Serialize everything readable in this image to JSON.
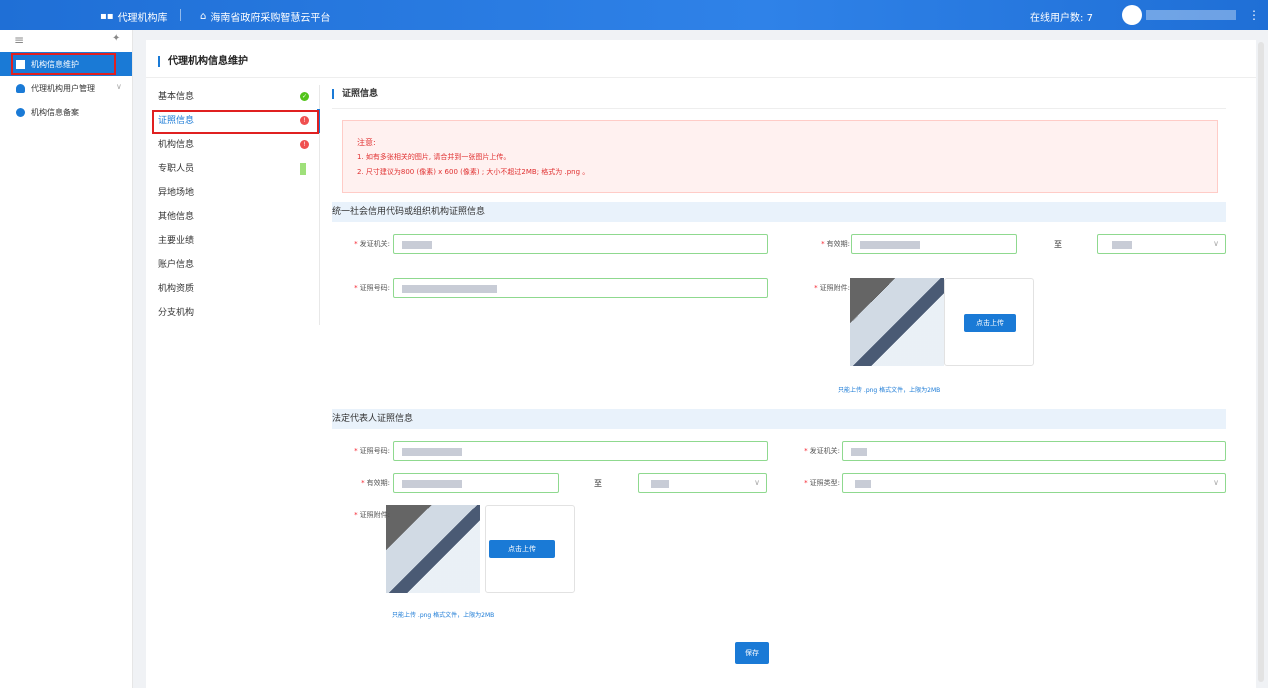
{
  "topbar": {
    "apps_icon": "grid-icon",
    "apps_label": "代理机构库",
    "home_icon": "home-icon",
    "platform": "海南省政府采购智慧云平台",
    "online_label": "在线用户数:",
    "online_count": "7",
    "more_icon": "more-icon"
  },
  "sidebar": {
    "menu_icon": "hamburger-icon",
    "pin_icon": "pin-icon",
    "items": [
      {
        "label": "机构信息维护",
        "icon": "info-icon"
      },
      {
        "label": "代理机构用户管理",
        "icon": "users-icon"
      },
      {
        "label": "机构信息备案",
        "icon": "gear-icon"
      }
    ]
  },
  "page_title": "代理机构信息维护",
  "nav": [
    {
      "label": "基本信息",
      "status": "ok"
    },
    {
      "label": "证照信息",
      "status": "err"
    },
    {
      "label": "机构信息",
      "status": "err"
    },
    {
      "label": "专职人员",
      "status": "bar"
    },
    {
      "label": "异地场地",
      "status": ""
    },
    {
      "label": "其他信息",
      "status": ""
    },
    {
      "label": "主要业绩",
      "status": ""
    },
    {
      "label": "账户信息",
      "status": ""
    },
    {
      "label": "机构资质",
      "status": ""
    },
    {
      "label": "分支机构",
      "status": ""
    }
  ],
  "section_title": "证照信息",
  "notice": {
    "title": "注意:",
    "line1": "1. 如有多张相关的图片, 请合并到一张图片上传。",
    "line2": "2. 尺寸建议为800 (像素) x 600 (像素) ; 大小不超过2MB; 格式为 .png 。"
  },
  "group1": {
    "title": "统一社会信用代码或组织机构证照信息",
    "issuer_label": "发证机关:",
    "validity_label": "有效期:",
    "to": "至",
    "cert_no_label": "证照号码:",
    "attach_label": "证照附件:",
    "upload_btn": "点击上传",
    "hint": "只能上传 .png 格式文件，上限为2MB"
  },
  "group2": {
    "title": "法定代表人证照信息",
    "cert_no_label": "证照号码:",
    "issuer_label": "发证机关:",
    "validity_label": "有效期:",
    "to": "至",
    "type_label": "证照类型:",
    "attach_label": "证照附件:",
    "upload_btn": "点击上传",
    "hint": "只能上传 .png 格式文件，上限为2MB"
  },
  "save_btn": "保存"
}
